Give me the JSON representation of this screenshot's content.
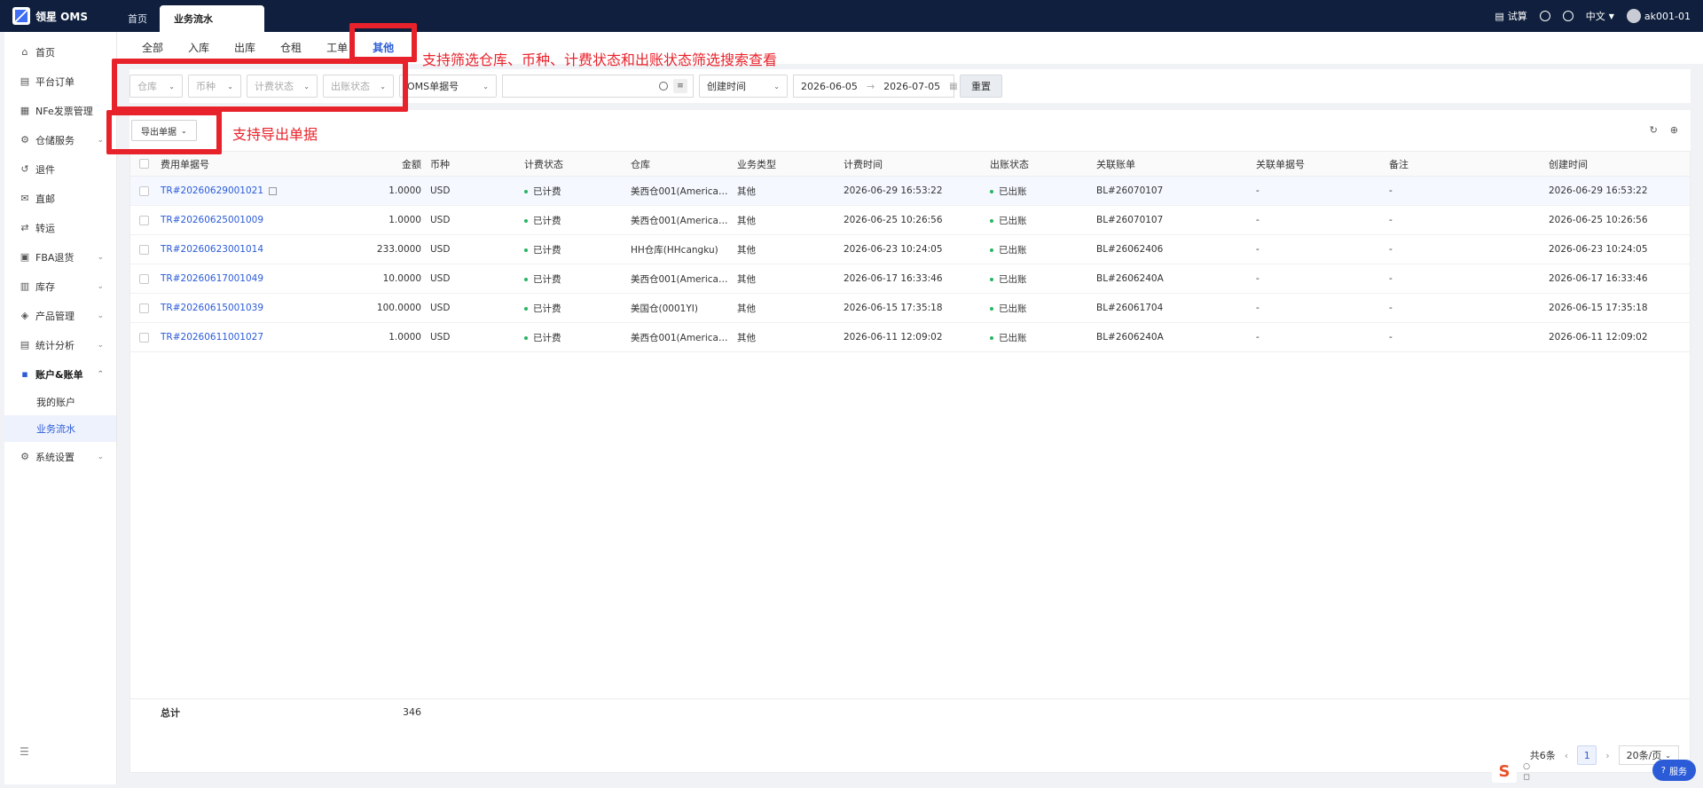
{
  "app": {
    "brand": "领星 OMS"
  },
  "top_tabs": [
    {
      "label": "首页"
    },
    {
      "label": "业务流水"
    }
  ],
  "topbar_right": {
    "calc": "试算",
    "language": "中文",
    "user": "ak001-01"
  },
  "sidebar": {
    "items": [
      {
        "label": "首页",
        "icon": "home-icon"
      },
      {
        "label": "平台订单",
        "icon": "list-icon"
      },
      {
        "label": "NFe发票管理",
        "icon": "invoice-icon"
      },
      {
        "label": "仓储服务",
        "icon": "warehouse-icon"
      },
      {
        "label": "退件",
        "icon": "return-icon"
      },
      {
        "label": "直邮",
        "icon": "mail-icon"
      },
      {
        "label": "转运",
        "icon": "transfer-icon"
      },
      {
        "label": "FBA退货",
        "icon": "fba-icon"
      },
      {
        "label": "库存",
        "icon": "stock-icon"
      },
      {
        "label": "产品管理",
        "icon": "product-icon"
      },
      {
        "label": "统计分析",
        "icon": "stats-icon"
      },
      {
        "label": "账户&账单",
        "icon": "account-icon"
      },
      {
        "label": "系统设置",
        "icon": "settings-icon"
      }
    ],
    "sub_items": [
      {
        "label": "我的账户"
      },
      {
        "label": "业务流水"
      }
    ]
  },
  "content_tabs": [
    {
      "label": "全部"
    },
    {
      "label": "入库"
    },
    {
      "label": "出库"
    },
    {
      "label": "仓租"
    },
    {
      "label": "工单"
    },
    {
      "label": "其他"
    }
  ],
  "filters": {
    "warehouse": "仓库",
    "currency": "币种",
    "billing_status": "计费状态",
    "settle_status": "出账状态",
    "search_type": "OMS单据号",
    "time_type": "创建时间",
    "date_start": "2026-06-05",
    "date_end": "2026-07-05",
    "reset": "重置"
  },
  "actions": {
    "export": "导出单据"
  },
  "table": {
    "columns": {
      "no": "费用单据号",
      "amount": "金额",
      "currency": "币种",
      "billing_status": "计费状态",
      "warehouse": "仓库",
      "biz_type": "业务类型",
      "billing_time": "计费时间",
      "settle_status": "出账状态",
      "related_bill": "关联账单",
      "related_no": "关联单据号",
      "memo": "备注",
      "created": "创建时间"
    },
    "rows": [
      {
        "no": "TR#20260629001021",
        "amount": "1.0000",
        "currency": "USD",
        "billing_status": "已计费",
        "warehouse": "美西仓001(American ...",
        "biz_type": "其他",
        "billing_time": "2026-06-29 16:53:22",
        "settle_status": "已出账",
        "related_bill": "BL#26070107",
        "related_no": "-",
        "memo": "-",
        "created": "2026-06-29 16:53:22"
      },
      {
        "no": "TR#20260625001009",
        "amount": "1.0000",
        "currency": "USD",
        "billing_status": "已计费",
        "warehouse": "美西仓001(American ...",
        "biz_type": "其他",
        "billing_time": "2026-06-25 10:26:56",
        "settle_status": "已出账",
        "related_bill": "BL#26070107",
        "related_no": "-",
        "memo": "-",
        "created": "2026-06-25 10:26:56"
      },
      {
        "no": "TR#20260623001014",
        "amount": "233.0000",
        "currency": "USD",
        "billing_status": "已计费",
        "warehouse": "HH仓库(HHcangku)",
        "biz_type": "其他",
        "billing_time": "2026-06-23 10:24:05",
        "settle_status": "已出账",
        "related_bill": "BL#26062406",
        "related_no": "-",
        "memo": "-",
        "created": "2026-06-23 10:24:05"
      },
      {
        "no": "TR#20260617001049",
        "amount": "10.0000",
        "currency": "USD",
        "billing_status": "已计费",
        "warehouse": "美西仓001(American ...",
        "biz_type": "其他",
        "billing_time": "2026-06-17 16:33:46",
        "settle_status": "已出账",
        "related_bill": "BL#2606240A",
        "related_no": "-",
        "memo": "-",
        "created": "2026-06-17 16:33:46"
      },
      {
        "no": "TR#20260615001039",
        "amount": "100.0000",
        "currency": "USD",
        "billing_status": "已计费",
        "warehouse": "美国仓(0001YI)",
        "biz_type": "其他",
        "billing_time": "2026-06-15 17:35:18",
        "settle_status": "已出账",
        "related_bill": "BL#26061704",
        "related_no": "-",
        "memo": "-",
        "created": "2026-06-15 17:35:18"
      },
      {
        "no": "TR#20260611001027",
        "amount": "1.0000",
        "currency": "USD",
        "billing_status": "已计费",
        "warehouse": "美西仓001(American ...",
        "biz_type": "其他",
        "billing_time": "2026-06-11 12:09:02",
        "settle_status": "已出账",
        "related_bill": "BL#2606240A",
        "related_no": "-",
        "memo": "-",
        "created": "2026-06-11 12:09:02"
      }
    ],
    "total_label": "总计",
    "total_value": "346"
  },
  "pagination": {
    "total": "共6条",
    "current": "1",
    "page_size": "20条/页"
  },
  "annotations": {
    "filter_note": "支持筛选仓库、币种、计费状态和出账状态筛选搜索查看",
    "export_note": "支持导出单据"
  },
  "floating": {
    "service": "服务",
    "s_logo": "S"
  },
  "colors": {
    "topbar": "#0f1f3d",
    "accent": "#2b5bd7",
    "annotation": "#e8222b",
    "status_dot": "#28b463"
  }
}
